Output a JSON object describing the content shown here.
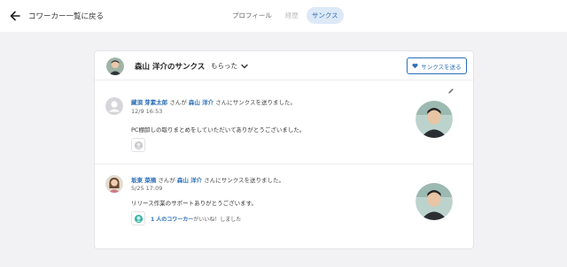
{
  "topbar": {
    "back_label": "コワーカー一覧に戻る",
    "tabs": [
      {
        "label": "プロフィール",
        "state": "normal"
      },
      {
        "label": "経歴",
        "state": "dim"
      },
      {
        "label": "サンクス",
        "state": "active"
      }
    ]
  },
  "card": {
    "title": "森山 洋介のサンクス",
    "filter_label": "もらった",
    "send_button_label": "サンクスを送る",
    "items": [
      {
        "sender": "藏須 芽素太郎",
        "conn1": " さんが ",
        "recipient": "森山 洋介",
        "conn2": " さんにサンクスを送りました。",
        "date": "12/9 16:53",
        "message": "PC棚卸しの取りまとめをしていただいてありがとうございました。",
        "reaction_count": "",
        "reaction_text": ""
      },
      {
        "sender": "坂東 菜摘",
        "conn1": " さんが ",
        "recipient": "森山 洋介",
        "conn2": " さんにサンクスを送りました。",
        "date": "5/25 17:09",
        "message": "リリース作業のサポートありがとうございます。",
        "reaction_count": "1 人のコワーカー",
        "reaction_text": "がいいね！しました"
      }
    ]
  },
  "colors": {
    "accent": "#2d6fb8",
    "active_tab_bg": "#dde9f7",
    "page_bg": "#f2f2f4"
  },
  "icons": {
    "back": "arrow-left-icon",
    "filter": "chevron-down-icon",
    "send": "heart-icon",
    "edit": "pencil-icon",
    "reaction_empty": "reaction-gray-icon",
    "reaction_liked": "reaction-teal-icon"
  }
}
